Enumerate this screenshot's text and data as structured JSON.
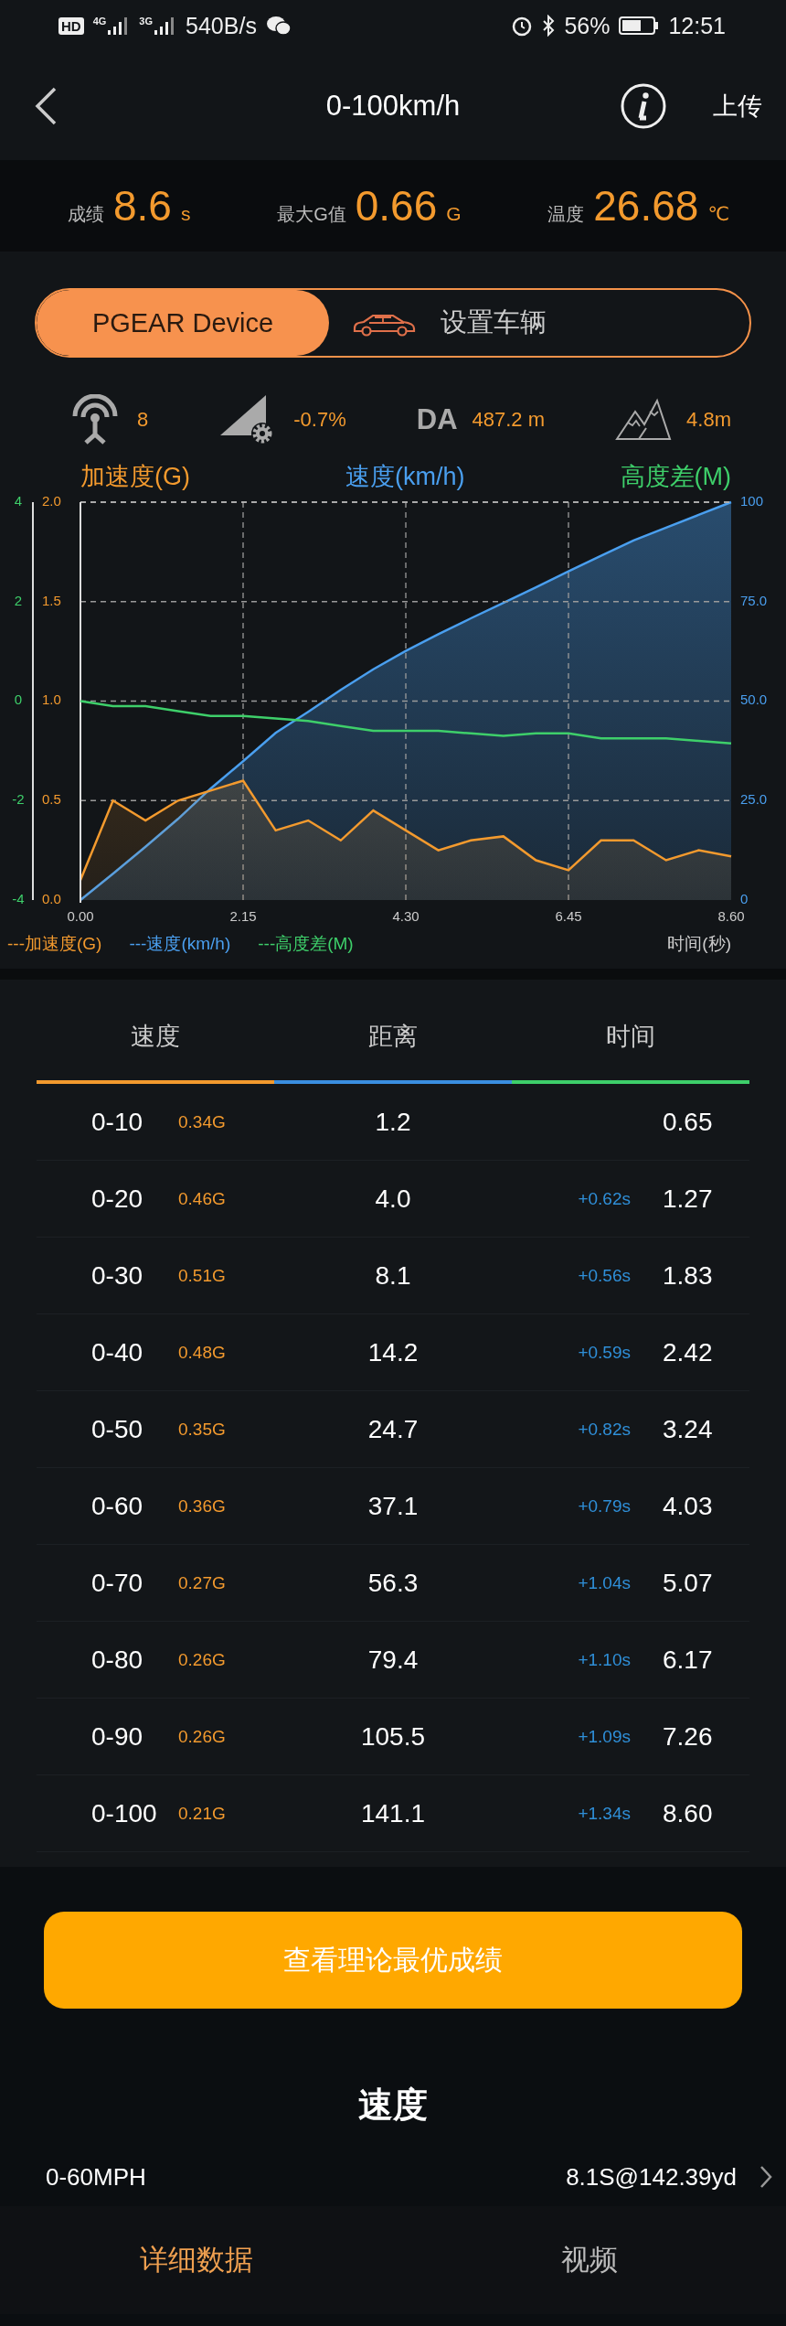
{
  "status_bar": {
    "hd_label": "HD",
    "sim1_label": "4G",
    "sim2_label": "3G",
    "network_speed": "540B/s",
    "battery": "56%",
    "time": "12:51"
  },
  "header": {
    "title": "0-100km/h",
    "upload": "上传"
  },
  "stats": [
    {
      "label": "成绩",
      "value": "8.6",
      "unit": "s"
    },
    {
      "label": "最大G值",
      "value": "0.66",
      "unit": "G"
    },
    {
      "label": "温度",
      "value": "26.68",
      "unit": "℃"
    }
  ],
  "toggle": [
    {
      "label": "PGEAR Device",
      "selected": true
    },
    {
      "label": "设置车辆",
      "selected": false
    }
  ],
  "metrics": [
    {
      "kind": "satellite",
      "value": "8"
    },
    {
      "kind": "slope",
      "value": "-0.7%"
    },
    {
      "kind": "da",
      "label": "DA",
      "value": "487.2 m"
    },
    {
      "kind": "altitude",
      "value": "4.8m"
    }
  ],
  "chart": {
    "charts": [
      {
        "chart_data": {
          "type": "area",
          "grid": true,
          "xlabel": "时间(秒)",
          "xlim": [
            0,
            8.6
          ],
          "ylim": [
            0,
            2
          ],
          "x": [
            0,
            0.43,
            0.86,
            1.29,
            1.72,
            2.15,
            2.58,
            3.01,
            3.44,
            3.87,
            4.3,
            4.73,
            5.16,
            5.59,
            6.02,
            6.45,
            6.88,
            7.31,
            7.74,
            8.17,
            8.6
          ],
          "xticks": [
            {
              "value": 0,
              "label": "0.00"
            },
            {
              "value": 2.15,
              "label": "2.15"
            },
            {
              "value": 4.3,
              "label": "4.30"
            },
            {
              "value": 6.45,
              "label": "6.45"
            },
            {
              "value": 8.6,
              "label": "8.60"
            }
          ],
          "yticks": [
            {
              "value": 2,
              "label": "2.0"
            },
            {
              "value": 1.5,
              "label": "1.5"
            },
            {
              "value": 1,
              "label": "1.0"
            },
            {
              "value": 0.5,
              "label": "0.5"
            },
            {
              "value": 0,
              "label": "0.0"
            }
          ],
          "series": [
            {
              "name": "加速度(G)",
              "color": "#f39a2e",
              "values": [
                0.1,
                0.5,
                0.4,
                0.5,
                0.55,
                0.6,
                0.35,
                0.4,
                0.3,
                0.45,
                0.35,
                0.25,
                0.3,
                0.32,
                0.2,
                0.15,
                0.3,
                0.3,
                0.2,
                0.25,
                0.22
              ]
            }
          ]
        }
      },
      {
        "chart_data": {
          "type": "area",
          "xlim": [
            0,
            8.6
          ],
          "ylim": [
            0,
            100
          ],
          "x": [
            0,
            0.43,
            0.86,
            1.29,
            1.72,
            2.15,
            2.58,
            3.01,
            3.44,
            3.87,
            4.3,
            4.73,
            5.16,
            5.59,
            6.02,
            6.45,
            6.88,
            7.31,
            7.74,
            8.17,
            8.6
          ],
          "yticks": [
            {
              "value": 100,
              "label": "100"
            },
            {
              "value": 75,
              "label": "75.0"
            },
            {
              "value": 50,
              "label": "50.0"
            },
            {
              "value": 25,
              "label": "25.0"
            },
            {
              "value": 0,
              "label": "0"
            }
          ],
          "series": [
            {
              "name": "速度(km/h)",
              "color": "#4a9fef",
              "values": [
                0,
                6.6,
                13.4,
                20.4,
                28,
                34.9,
                42,
                47.3,
                52.8,
                58,
                62.6,
                66.8,
                70.8,
                74.7,
                78.6,
                82.6,
                86.5,
                90.4,
                93.6,
                96.8,
                100
              ]
            }
          ]
        }
      },
      {
        "chart_data": {
          "type": "line",
          "xlim": [
            0,
            8.6
          ],
          "ylim": [
            -4,
            4
          ],
          "x": [
            0,
            0.43,
            0.86,
            1.29,
            1.72,
            2.15,
            2.58,
            3.01,
            3.44,
            3.87,
            4.3,
            4.73,
            5.16,
            5.59,
            6.02,
            6.45,
            6.88,
            7.31,
            7.74,
            8.17,
            8.6
          ],
          "yticks": [
            {
              "value": 4,
              "label": "4"
            },
            {
              "value": 2,
              "label": "2"
            },
            {
              "value": 0,
              "label": "0"
            },
            {
              "value": -2,
              "label": "-2"
            },
            {
              "value": -4,
              "label": "-4"
            }
          ],
          "series": [
            {
              "name": "高度差(M)",
              "color": "#3ecf6a",
              "values": [
                0,
                -0.1,
                -0.1,
                -0.2,
                -0.3,
                -0.3,
                -0.35,
                -0.4,
                -0.5,
                -0.6,
                -0.6,
                -0.6,
                -0.65,
                -0.7,
                -0.65,
                -0.65,
                -0.75,
                -0.75,
                -0.75,
                -0.8,
                -0.85
              ]
            }
          ]
        }
      }
    ],
    "legend": [
      "---加速度(G)",
      "---速度(km/h)",
      "---高度差(M)"
    ]
  },
  "table": {
    "columns": [
      {
        "label": "速度",
        "color": "#f39a2e"
      },
      {
        "label": "距离",
        "color": "#3a8ee0"
      },
      {
        "label": "时间",
        "color": "#3ecf6a"
      }
    ],
    "rows": [
      {
        "range": "0-10",
        "g": "0.34G",
        "distance": "1.2",
        "time": "0.65"
      },
      {
        "range": "0-20",
        "g": "0.46G",
        "distance": "4.0",
        "delta": "+0.62s",
        "time": "1.27"
      },
      {
        "range": "0-30",
        "g": "0.51G",
        "distance": "8.1",
        "delta": "+0.56s",
        "time": "1.83"
      },
      {
        "range": "0-40",
        "g": "0.48G",
        "distance": "14.2",
        "delta": "+0.59s",
        "time": "2.42"
      },
      {
        "range": "0-50",
        "g": "0.35G",
        "distance": "24.7",
        "delta": "+0.82s",
        "time": "3.24"
      },
      {
        "range": "0-60",
        "g": "0.36G",
        "distance": "37.1",
        "delta": "+0.79s",
        "time": "4.03"
      },
      {
        "range": "0-70",
        "g": "0.27G",
        "distance": "56.3",
        "delta": "+1.04s",
        "time": "5.07"
      },
      {
        "range": "0-80",
        "g": "0.26G",
        "distance": "79.4",
        "delta": "+1.10s",
        "time": "6.17"
      },
      {
        "range": "0-90",
        "g": "0.26G",
        "distance": "105.5",
        "delta": "+1.09s",
        "time": "7.26"
      },
      {
        "range": "0-100",
        "g": "0.21G",
        "distance": "141.1",
        "delta": "+1.34s",
        "time": "8.60"
      }
    ]
  },
  "best_button": "查看理论最优成绩",
  "speed_section": {
    "title": "速度",
    "items": [
      {
        "label": "0-60MPH",
        "value": "8.1S@142.39yd"
      }
    ]
  },
  "bottom_tabs": [
    {
      "label": "详细数据",
      "selected": true
    },
    {
      "label": "视频",
      "selected": false
    }
  ]
}
